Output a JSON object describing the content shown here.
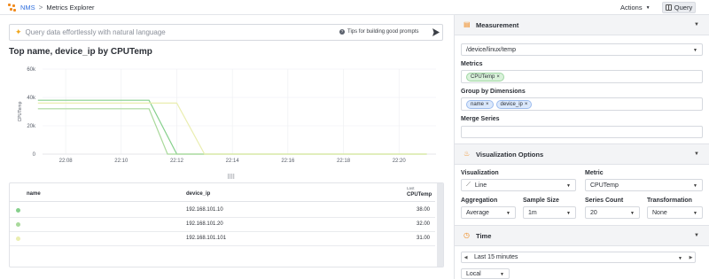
{
  "header": {
    "app_name": "NMS",
    "separator": ">",
    "page_title": "Metrics Explorer",
    "actions_label": "Actions",
    "query_label": "Query"
  },
  "search": {
    "placeholder": "Query data effortlessly with natural language",
    "tips_label": "Tips for building good prompts"
  },
  "chart": {
    "title": "Top name, device_ip by CPUTemp",
    "drag_handle": "⠿⠿"
  },
  "chart_data": {
    "type": "line",
    "title": "Top name, device_ip by CPUTemp",
    "xlabel": "",
    "ylabel": "CPUTemp",
    "y_ticks": [
      "60k",
      "40k",
      "20k",
      "0"
    ],
    "x_ticks": [
      "22:08",
      "22:10",
      "22:12",
      "22:14",
      "22:16",
      "22:18",
      "22:20"
    ],
    "ylim": [
      0,
      60000
    ],
    "grid": true,
    "series": [
      {
        "name": "",
        "color": "#86d08c",
        "points": [
          [
            "22:07",
            38000
          ],
          [
            "22:10",
            38000
          ],
          [
            "22:11",
            38000
          ],
          [
            "22:12",
            0
          ],
          [
            "22:21",
            0
          ]
        ]
      },
      {
        "name": "",
        "color": "#a9d99b",
        "points": [
          [
            "22:07",
            32000
          ],
          [
            "22:10",
            32000
          ],
          [
            "22:11",
            32000
          ],
          [
            "22:11:40",
            0
          ],
          [
            "22:21",
            0
          ]
        ]
      },
      {
        "name": "",
        "color": "#eaeeb0",
        "points": [
          [
            "22:07",
            36000
          ],
          [
            "22:10",
            36000
          ],
          [
            "22:12",
            36000
          ],
          [
            "22:13",
            0
          ],
          [
            "22:21",
            0
          ]
        ]
      }
    ]
  },
  "table": {
    "col_name": "name",
    "col_device_ip": "device_ip",
    "col_last_sub": "Last",
    "col_cputemp": "CPUTemp",
    "rows": [
      {
        "color": "#86d08c",
        "name": "",
        "device_ip": "192.168.101.10",
        "value": "38.00"
      },
      {
        "color": "#a9d99b",
        "name": "",
        "device_ip": "192.168.101.20",
        "value": "32.00"
      },
      {
        "color": "#eaeeb0",
        "name": "",
        "device_ip": "192.168.101.101",
        "value": "31.00"
      }
    ]
  },
  "panel": {
    "measurement_title": "Measurement",
    "measurement_value": "/device/linux/temp",
    "metrics_label": "Metrics",
    "metric_tag": "CPUTemp",
    "group_label": "Group by Dimensions",
    "group_tags": [
      "name",
      "device_ip"
    ],
    "merge_label": "Merge Series",
    "viz_title": "Visualization Options",
    "visualization_label": "Visualization",
    "visualization_value": "Line",
    "metric_label": "Metric",
    "metric_value": "CPUTemp",
    "aggregation_label": "Aggregation",
    "aggregation_value": "Average",
    "sample_label": "Sample Size",
    "sample_value": "1m",
    "series_count_label": "Series Count",
    "series_count_value": "20",
    "transformation_label": "Transformation",
    "transformation_value": "None",
    "time_title": "Time",
    "time_range": "Last 15 minutes",
    "timezone": "Local"
  },
  "colors": {
    "accent_orange": "#f08a1d",
    "link_blue": "#2f6fde"
  }
}
